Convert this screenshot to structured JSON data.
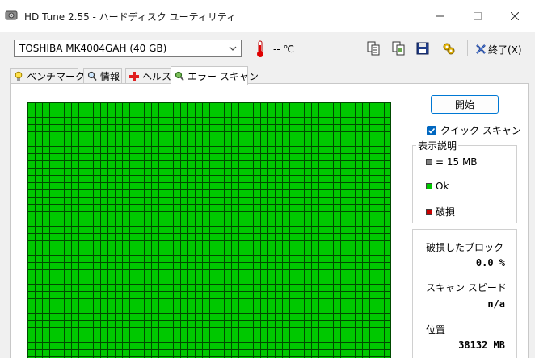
{
  "window": {
    "title": "HD Tune 2.55 - ハードディスク ユーティリティ",
    "controls": {
      "minimize": "—",
      "maximize": "☐",
      "close": "✕"
    }
  },
  "toolbar": {
    "drive": "TOSHIBA MK4004GAH (40 GB)",
    "temperature": "-- ℃",
    "icons": [
      "copy-text-icon",
      "copy-image-icon",
      "save-icon",
      "options-icon"
    ],
    "exit_label": "終了(X)"
  },
  "tabs": [
    {
      "label": "ベンチマーク",
      "icon": "bulb-icon",
      "active": false
    },
    {
      "label": "情報",
      "icon": "magnifier-icon",
      "active": false
    },
    {
      "label": "ヘルス",
      "icon": "red-cross-icon",
      "active": false
    },
    {
      "label": "エラー スキャン",
      "icon": "search-icon",
      "active": true
    }
  ],
  "scan": {
    "start_label": "開始",
    "quick_scan_label": "クイック スキャン",
    "quick_scan_checked": true,
    "block_status": "ok"
  },
  "legend": {
    "title": "表示説明",
    "items": [
      {
        "label": "= 15 MB",
        "color": "#808080"
      },
      {
        "label": "Ok",
        "color": "#00c800"
      },
      {
        "label": "破損",
        "color": "#c80000"
      }
    ]
  },
  "stats": {
    "damaged_label": "破損したブロック",
    "damaged_value": "0.0 %",
    "speed_label": "スキャン スピード",
    "speed_value": "n/a",
    "position_label": "位置",
    "position_value": "38132 MB"
  }
}
